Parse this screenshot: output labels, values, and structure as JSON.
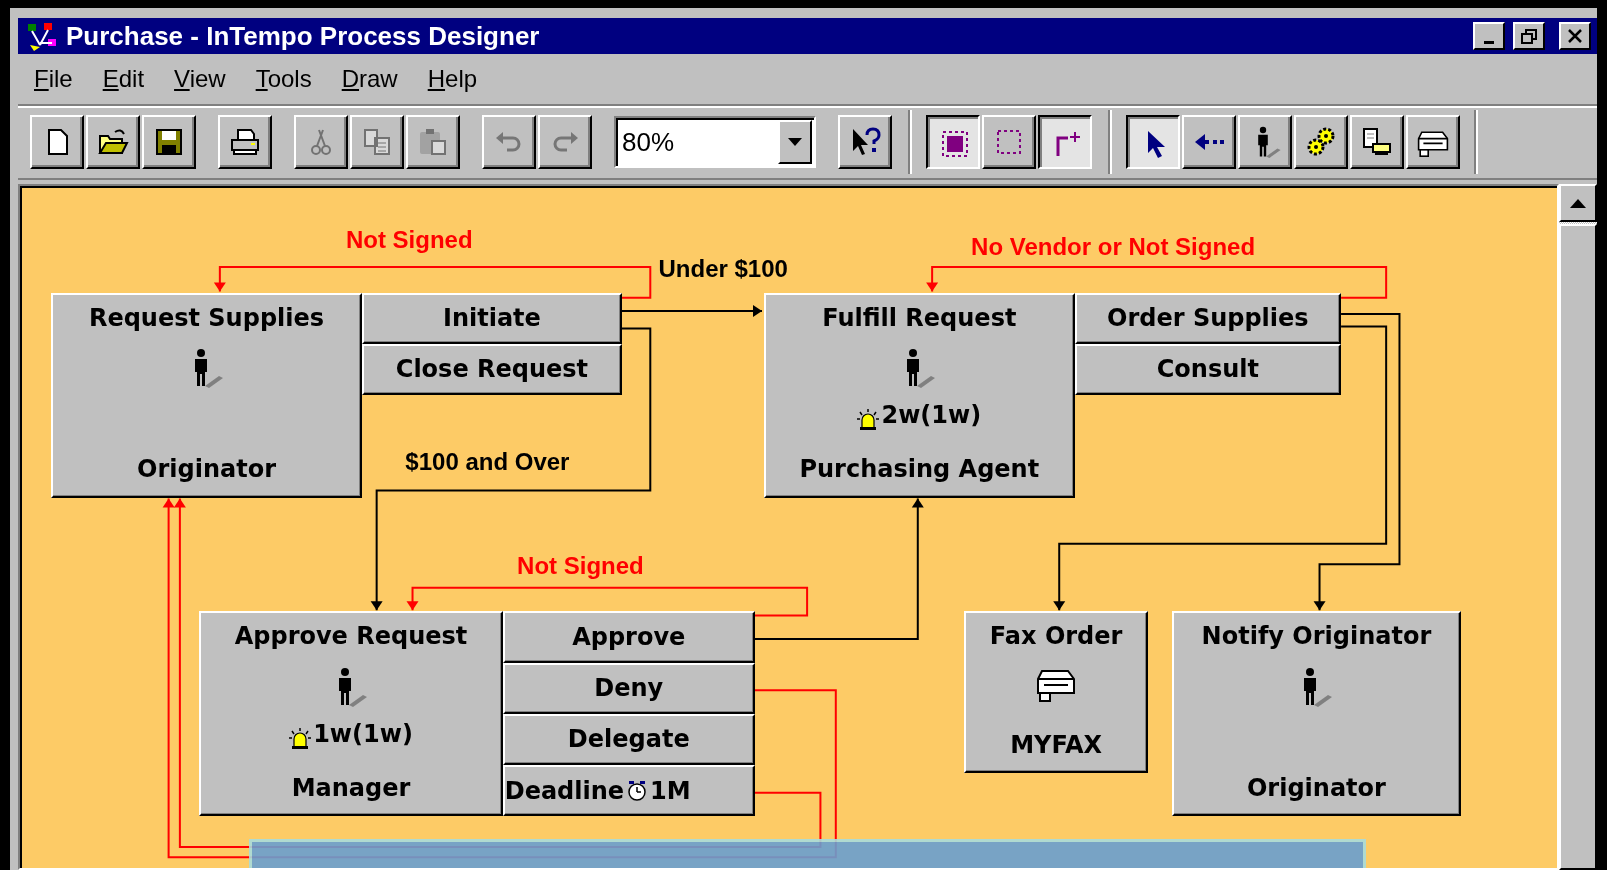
{
  "window": {
    "title": "Purchase - InTempo Process Designer"
  },
  "menu": [
    {
      "label": "File"
    },
    {
      "label": "Edit"
    },
    {
      "label": "View"
    },
    {
      "label": "Tools"
    },
    {
      "label": "Draw"
    },
    {
      "label": "Help"
    }
  ],
  "toolbar": {
    "sections": [
      {
        "groups": [
          [
            {
              "kind": "new",
              "disabled": false,
              "pressed": false
            },
            {
              "kind": "open",
              "disabled": false,
              "pressed": false
            },
            {
              "kind": "save",
              "disabled": false,
              "pressed": false
            }
          ],
          [
            {
              "kind": "print",
              "disabled": false,
              "pressed": false
            }
          ],
          [
            {
              "kind": "cut",
              "disabled": true,
              "pressed": false
            },
            {
              "kind": "copy",
              "disabled": true,
              "pressed": false
            },
            {
              "kind": "paste",
              "disabled": true,
              "pressed": false
            }
          ],
          [
            {
              "kind": "undo",
              "disabled": true,
              "pressed": false
            },
            {
              "kind": "redo",
              "disabled": true,
              "pressed": false
            }
          ],
          [
            {
              "kind": "zoom",
              "value": "80%"
            }
          ],
          [
            {
              "kind": "help",
              "disabled": false,
              "pressed": false
            }
          ]
        ]
      },
      {
        "groups": [
          [
            {
              "kind": "select-node",
              "disabled": false,
              "pressed": true
            },
            {
              "kind": "select-frame",
              "disabled": false,
              "pressed": false
            },
            {
              "kind": "connect",
              "disabled": false,
              "pressed": true
            }
          ]
        ]
      },
      {
        "groups": [
          [
            {
              "kind": "pointer",
              "disabled": false,
              "pressed": true
            },
            {
              "kind": "back-link",
              "disabled": false,
              "pressed": false
            },
            {
              "kind": "person",
              "disabled": false,
              "pressed": false
            },
            {
              "kind": "gears",
              "disabled": false,
              "pressed": false
            },
            {
              "kind": "document-printer",
              "disabled": false,
              "pressed": false
            },
            {
              "kind": "fax",
              "disabled": false,
              "pressed": false
            }
          ]
        ]
      }
    ]
  },
  "diagram": {
    "nodes": [
      {
        "title": "Request Supplies",
        "kind": "person",
        "role": "Originator",
        "actions": [
          {
            "kind": "plain",
            "label": "Initiate"
          },
          {
            "kind": "plain",
            "label": "Close Request"
          }
        ]
      },
      {
        "title": "Fulfill Request",
        "kind": "person",
        "deadline": "2w(1w)",
        "role": "Purchasing Agent",
        "actions": [
          {
            "kind": "plain",
            "label": "Order Supplies"
          },
          {
            "kind": "plain",
            "label": "Consult"
          }
        ]
      },
      {
        "title": "Approve Request",
        "kind": "person",
        "deadline": "1w(1w)",
        "role": "Manager",
        "actions": [
          {
            "kind": "plain",
            "label": "Approve"
          },
          {
            "kind": "plain",
            "label": "Deny"
          },
          {
            "kind": "plain",
            "label": "Delegate"
          },
          {
            "kind": "deadline",
            "label": "Deadline",
            "value": "1M"
          }
        ]
      },
      {
        "title": "Fax Order",
        "kind": "fax",
        "role": "MYFAX"
      },
      {
        "title": "Notify Originator",
        "kind": "person",
        "role": "Originator"
      }
    ],
    "edge_labels": [
      {
        "text": "Not Signed",
        "kind": "rejection"
      },
      {
        "text": "Under $100",
        "kind": "route"
      },
      {
        "text": "No Vendor or Not Signed",
        "kind": "rejection"
      },
      {
        "text": "$100 and Over",
        "kind": "route"
      },
      {
        "text": "Not Signed",
        "kind": "rejection"
      }
    ]
  }
}
